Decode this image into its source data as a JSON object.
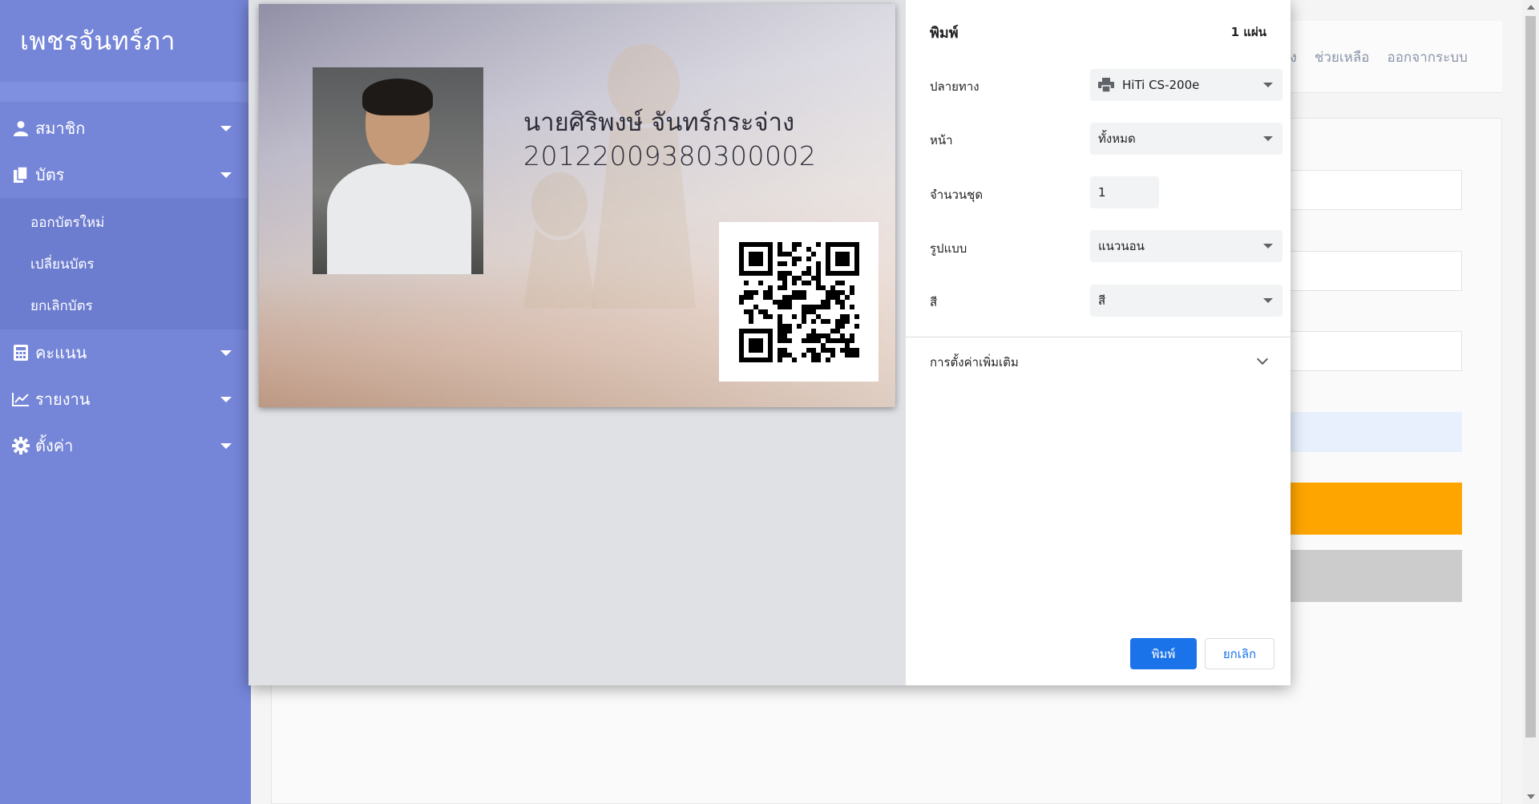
{
  "sidebar": {
    "brand": "เพชรจันทร์ภา",
    "menu": [
      {
        "label": "สมาชิก",
        "icon": "user-icon"
      },
      {
        "label": "บัตร",
        "icon": "copy-icon"
      },
      {
        "label": "คะแนน",
        "icon": "calculator-icon"
      },
      {
        "label": "รายงาน",
        "icon": "line-chart-icon"
      },
      {
        "label": "ตั้งค่า",
        "icon": "gear-icon"
      }
    ],
    "card_submenu": [
      "ออกบัตรใหม่",
      "เปลี่ยนบัตร",
      "ยกเลิกบัตร"
    ]
  },
  "background_nav": {
    "partial_link": "จ้าง",
    "help": "ช่วยเหลือ",
    "logout": "ออกจากระบบ"
  },
  "card": {
    "name": "นายศิริพงษ์ จันทร์กระจ่าง",
    "member_id": "20122009380300002"
  },
  "print_dialog": {
    "title": "พิมพ์",
    "sheet_count": "1 แผ่น",
    "destination_label": "ปลายทาง",
    "destination_value": "HiTi CS-200e",
    "pages_label": "หน้า",
    "pages_value": "ทั้งหมด",
    "copies_label": "จำนวนชุด",
    "copies_value": "1",
    "layout_label": "รูปแบบ",
    "layout_value": "แนวนอน",
    "color_label": "สี",
    "color_value": "สี",
    "more_settings": "การตั้งค่าเพิ่มเติม",
    "print_button": "พิมพ์",
    "cancel_button": "ยกเลิก"
  },
  "colors": {
    "sidebar": "#7585d8",
    "primary_button": "#1a73e8",
    "bg_orange": "#ffa500"
  }
}
